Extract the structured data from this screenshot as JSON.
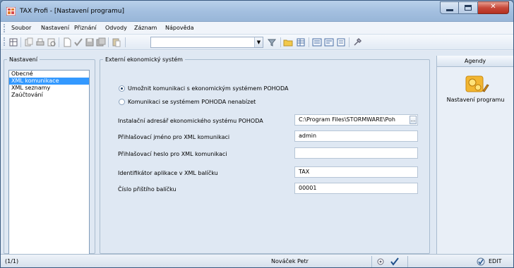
{
  "window": {
    "title": "TAX Profi - [Nastavení programu]",
    "buttons": {
      "minimize": "–",
      "maximize": "□",
      "close": "✕"
    }
  },
  "menu": {
    "items": [
      "Soubor",
      "Nastavení",
      "Přiznání",
      "Odvody",
      "Záznam",
      "Nápověda"
    ]
  },
  "toolbar": {
    "combo_value": "",
    "icons": [
      "grid-icon",
      "copy-icon",
      "print-icon",
      "preview-icon",
      "new-icon",
      "check-icon",
      "save-icon",
      "save-all-icon",
      "paste-icon",
      "filter-icon",
      "folder-icon",
      "table-icon",
      "list-icon",
      "list2-icon",
      "doc-icon",
      "tools-icon"
    ]
  },
  "nav": {
    "legend": "Nastavení",
    "items": [
      {
        "label": "Obecné",
        "selected": false
      },
      {
        "label": "XML komunikace",
        "selected": true
      },
      {
        "label": "XML seznamy",
        "selected": false
      },
      {
        "label": "Zaúčtování",
        "selected": false
      }
    ]
  },
  "ext": {
    "legend": "Externí ekonomický systém",
    "radio_enable": "Umožnit komunikaci s ekonomickým systémem POHODA",
    "radio_disable": "Komunikaci se systémem POHODA nenabízet",
    "radio_selected": "enable",
    "fields": [
      {
        "label": "Instalační adresář ekonomického systému POHODA",
        "value": "C:\\Program Files\\STORMWARE\\Poh",
        "has_button": true
      },
      {
        "label": "Přihlašovací jméno pro XML komunikaci",
        "value": "admin"
      },
      {
        "label": "Přihlašovací heslo pro XML komunikaci",
        "value": ""
      },
      {
        "label": "Identifikátor aplikace v XML balíčku",
        "value": "TAX"
      },
      {
        "label": "Číslo přištího balíčku",
        "value": "00001"
      }
    ],
    "browse_label": "..."
  },
  "agenda": {
    "header": "Agendy",
    "item_label": "Nastavení programu"
  },
  "status": {
    "record": "(1/1)",
    "user": "Nováček Petr",
    "mode": "EDIT"
  },
  "colors": {
    "selection": "#3399ff",
    "title_bar": "#a4c0e0",
    "close_button": "#c7493a"
  }
}
